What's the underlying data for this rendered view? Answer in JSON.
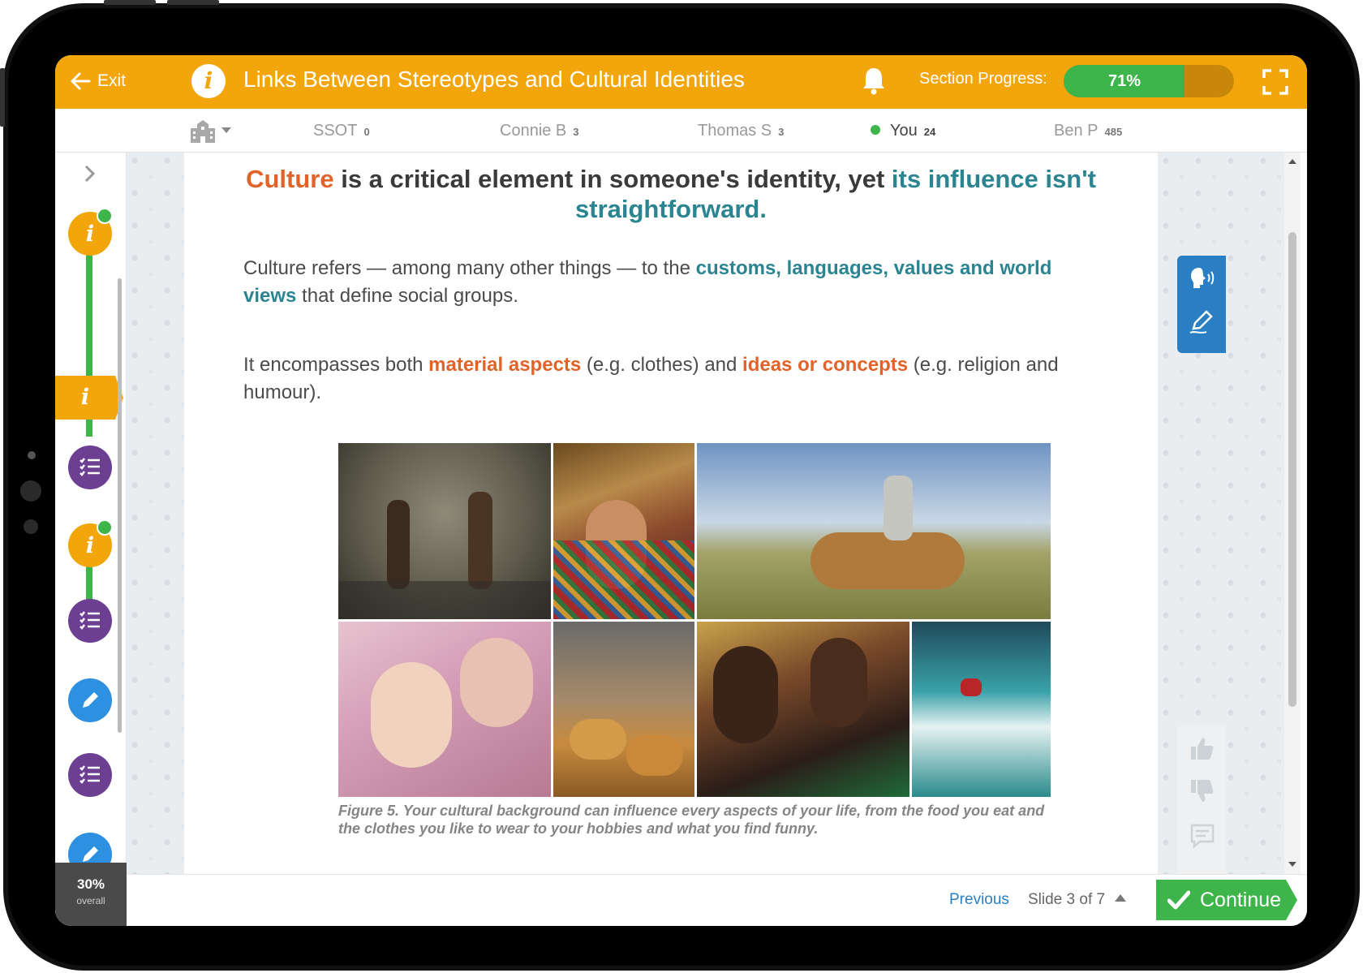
{
  "header": {
    "exit_label": "Exit",
    "info_glyph": "i",
    "title": "Links Between Stereotypes and Cultural Identities",
    "progress_label": "Section Progress:",
    "progress_value": 0.71,
    "progress_text": "71%"
  },
  "leaderboard": [
    {
      "name": "SSOT",
      "score": "0"
    },
    {
      "name": "Connie B",
      "score": "3"
    },
    {
      "name": "Thomas S",
      "score": "3"
    },
    {
      "name": "You",
      "score": "24"
    },
    {
      "name": "Ben P",
      "score": "485"
    }
  ],
  "nav": {
    "node_glyph": "i",
    "overall_pct": "30%",
    "overall_label": "overall",
    "icons": [
      "chevron-right-icon",
      "info-icon",
      "checklist-icon",
      "pencil-icon"
    ]
  },
  "content": {
    "headline": {
      "part1": "Culture",
      "part2": " is a critical element in someone's identity, yet ",
      "part3": "its influence isn't straightforward."
    },
    "p1": {
      "text1": "Culture refers — among many other things — to the ",
      "bold": "customs, languages, values and world views",
      "text2": " that define social groups."
    },
    "p2": {
      "text1": "It encompasses both ",
      "bold1": "material aspects",
      "text2": " (e.g. clothes) and ",
      "bold2": "ideas or concepts",
      "text3": " (e.g. religion and humour)."
    },
    "caption": "Figure 5. Your cultural background can influence every aspects of your life, from the food you eat and the clothes you like to wear to your hobbies and what you find funny."
  },
  "footer": {
    "previous_label": "Previous",
    "slide_label": "Slide 3 of 7",
    "continue_label": "Continue"
  },
  "colors": {
    "brand_orange": "#f2a60c",
    "progress_green": "#3db54a",
    "teal_accent": "#2a8591",
    "orange_accent": "#e2632a",
    "list_purple": "#6d3f93",
    "edit_blue": "#2e90e0"
  }
}
